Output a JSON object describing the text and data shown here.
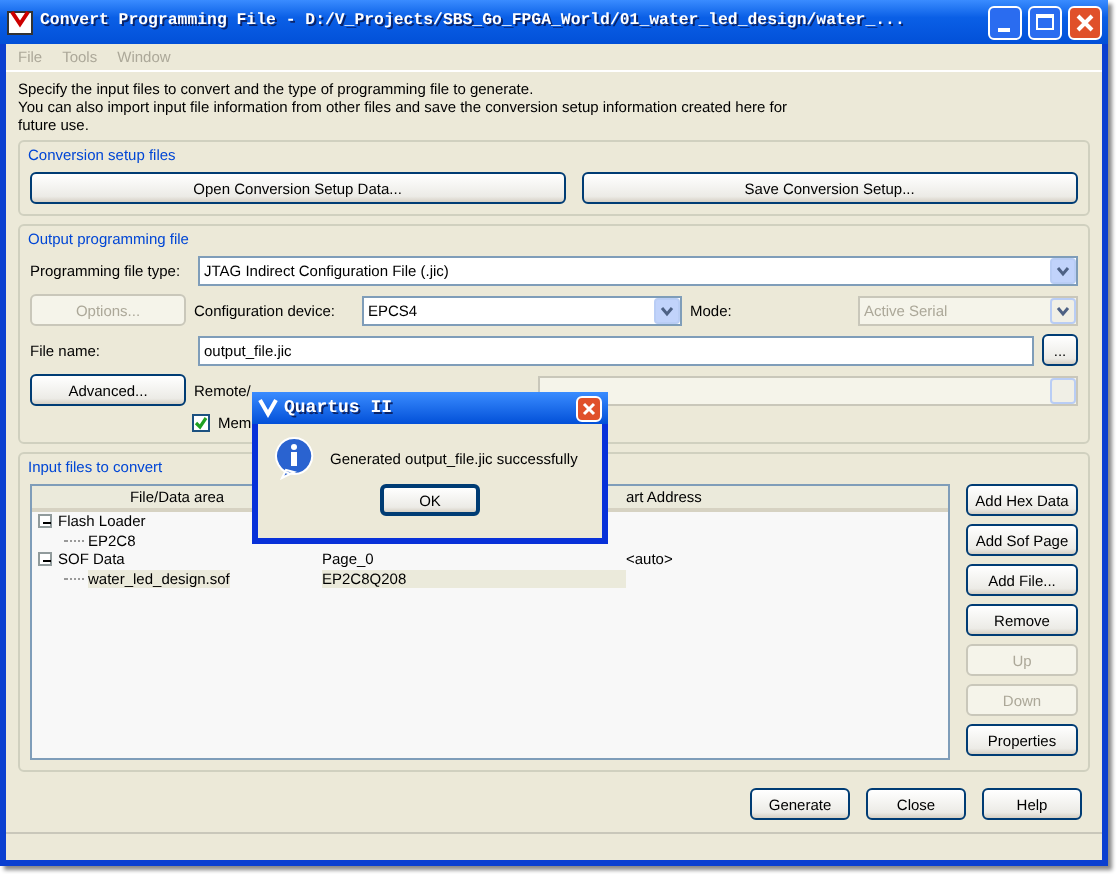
{
  "window": {
    "title": "Convert Programming File - D:/V_Projects/SBS_Go_FPGA_World/01_water_led_design/water_..."
  },
  "menu": [
    {
      "label": "File",
      "disabled": true
    },
    {
      "label": "Tools",
      "disabled": true
    },
    {
      "label": "Window",
      "disabled": true
    }
  ],
  "description": [
    "Specify the input files to convert and the type of programming file to generate.",
    "You can also import input file information from other files and save the conversion setup information created here for future use."
  ],
  "conversion_setup": {
    "title": "Conversion setup files",
    "buttons": [
      "Open Conversion Setup Data...",
      "Save Conversion Setup..."
    ]
  },
  "output": {
    "title": "Output programming file",
    "file_type": {
      "label": "Programming file type:",
      "value": "JTAG Indirect Configuration File (.jic)"
    },
    "options_button": {
      "label": "Options...",
      "disabled": true
    },
    "config_device": {
      "label": "Configuration device:",
      "value": "EPCS4"
    },
    "mode": {
      "label": "Mode:",
      "value": "Active Serial",
      "disabled": true
    },
    "file_name": {
      "label": "File name:",
      "value": "output_file.jic"
    },
    "browse_button": "...",
    "advanced_button": "Advanced...",
    "remote": {
      "label": "Remote/",
      "disabled": true
    },
    "memory_map": {
      "label": "Mem",
      "checked": true
    }
  },
  "input_files": {
    "title": "Input files to convert",
    "header": {
      "column_1": "File/Data area",
      "column_3": "art Address"
    },
    "tree": [
      {
        "name": "Flash Loader",
        "expanded": true,
        "selected": false,
        "children": [
          {
            "name": "EP2C8",
            "selected": false
          }
        ]
      },
      {
        "name": "SOF Data",
        "properties": "Page_0",
        "address": "<auto>",
        "expanded": true,
        "selected": false,
        "children": [
          {
            "name": "water_led_design.sof",
            "properties": "EP2C8Q208",
            "selected": true
          }
        ]
      }
    ],
    "buttons": [
      {
        "label": "Add Hex Data",
        "disabled": false
      },
      {
        "label": "Add Sof Page",
        "disabled": false
      },
      {
        "label": "Add File...",
        "disabled": false
      },
      {
        "label": "Remove",
        "disabled": false
      },
      {
        "label": "Up",
        "disabled": true
      },
      {
        "label": "Down",
        "disabled": true
      },
      {
        "label": "Properties",
        "disabled": false
      }
    ]
  },
  "footer_buttons": [
    "Generate",
    "Close",
    "Help"
  ],
  "dialog": {
    "title": "Quartus II",
    "message": "Generated output_file.jic successfully",
    "ok": "OK"
  }
}
